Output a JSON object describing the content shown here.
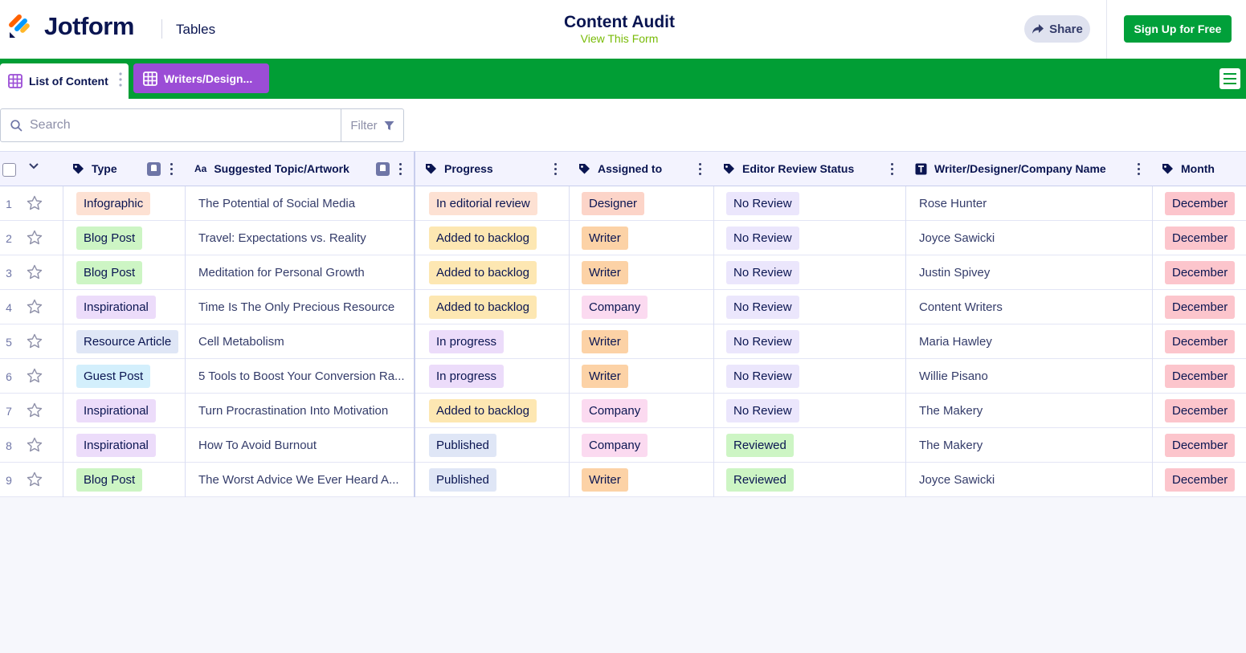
{
  "header": {
    "brand": "Jotform",
    "section": "Tables",
    "title": "Content Audit",
    "subtitle": "View This Form",
    "share_label": "Share",
    "signup_label": "Sign Up for Free"
  },
  "tabs": [
    {
      "label": "List of Content",
      "active": true
    },
    {
      "label": "Writers/Design...",
      "active": false
    }
  ],
  "toolbar": {
    "search_placeholder": "Search",
    "filter_label": "Filter"
  },
  "colors": {
    "brand_green": "#01a03a",
    "tab_purple": "#9b4dd6",
    "subtitle_green": "#78bb07"
  },
  "columns": [
    {
      "label": "Type",
      "icon": "tag-icon",
      "pinned": true
    },
    {
      "label": "Suggested Topic/Artwork",
      "icon": "text-aa-icon",
      "pinned": true
    },
    {
      "label": "Progress",
      "icon": "tag-icon"
    },
    {
      "label": "Assigned to",
      "icon": "tag-icon"
    },
    {
      "label": "Editor Review Status",
      "icon": "tag-icon"
    },
    {
      "label": "Writer/Designer/Company Name",
      "icon": "text-t-icon"
    },
    {
      "label": "Month",
      "icon": "tag-icon"
    }
  ],
  "rows": [
    {
      "num": "1",
      "type": "Infographic",
      "topic": "The Potential of Social Media",
      "progress": "In editorial review",
      "assigned": "Designer",
      "review": "No Review",
      "name": "Rose Hunter",
      "month": "December"
    },
    {
      "num": "2",
      "type": "Blog Post",
      "topic": "Travel: Expectations vs. Reality",
      "progress": "Added to backlog",
      "assigned": "Writer",
      "review": "No Review",
      "name": "Joyce Sawicki",
      "month": "December"
    },
    {
      "num": "3",
      "type": "Blog Post",
      "topic": "Meditation for Personal Growth",
      "progress": "Added to backlog",
      "assigned": "Writer",
      "review": "No Review",
      "name": "Justin Spivey",
      "month": "December"
    },
    {
      "num": "4",
      "type": "Inspirational",
      "topic": "Time Is The Only Precious Resource",
      "progress": "Added to backlog",
      "assigned": "Company",
      "review": "No Review",
      "name": "Content Writers",
      "month": "December"
    },
    {
      "num": "5",
      "type": "Resource Article",
      "topic": "Cell Metabolism",
      "progress": "In progress",
      "assigned": "Writer",
      "review": "No Review",
      "name": "Maria Hawley",
      "month": "December"
    },
    {
      "num": "6",
      "type": "Guest Post",
      "topic": "5 Tools to Boost Your Conversion Ra...",
      "progress": "In progress",
      "assigned": "Writer",
      "review": "No Review",
      "name": "Willie Pisano",
      "month": "December"
    },
    {
      "num": "7",
      "type": "Inspirational",
      "topic": "Turn Procrastination Into Motivation",
      "progress": "Added to backlog",
      "assigned": "Company",
      "review": "No Review",
      "name": "The Makery",
      "month": "December"
    },
    {
      "num": "8",
      "type": "Inspirational",
      "topic": "How To Avoid Burnout",
      "progress": "Published",
      "assigned": "Company",
      "review": "Reviewed",
      "name": "The Makery",
      "month": "December"
    },
    {
      "num": "9",
      "type": "Blog Post",
      "topic": "The Worst Advice We Ever Heard A...",
      "progress": "Published",
      "assigned": "Writer",
      "review": "Reviewed",
      "name": "Joyce Sawicki",
      "month": "December"
    }
  ],
  "tag_colors": {
    "Infographic": "#fde1d3",
    "Blog Post": "#cdf5c4",
    "Inspirational": "#ecdcfa",
    "Resource Article": "#dfe6f6",
    "Guest Post": "#d3effc",
    "In editorial review": "#fde1d3",
    "Added to backlog": "#fde7b2",
    "In progress": "#ecdcfa",
    "Published": "#dfe6f6",
    "Designer": "#fcd4c8",
    "Writer": "#fcd2a6",
    "Company": "#fbdaf0",
    "No Review": "#ebe6fc",
    "Reviewed": "#cdf5c4",
    "December": "#fcc5cc"
  }
}
